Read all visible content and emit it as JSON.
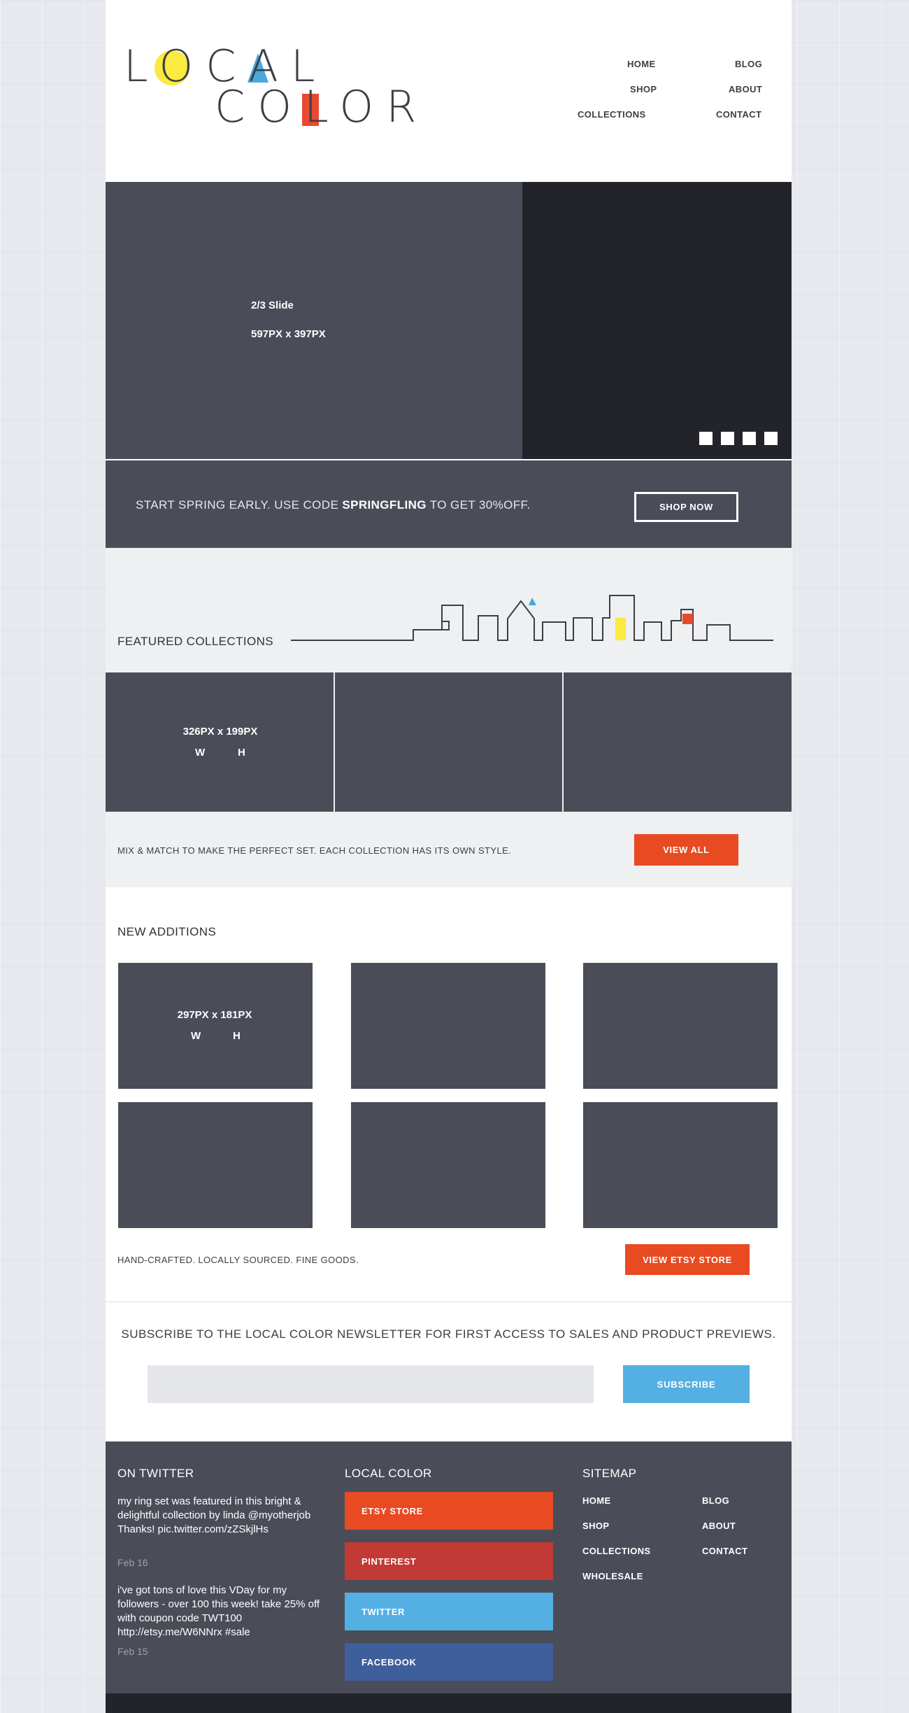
{
  "logo": {
    "line1": "LOCAL",
    "line2": "COLOR"
  },
  "nav": {
    "items": [
      "HOME",
      "BLOG",
      "SHOP",
      "ABOUT",
      "COLLECTIONS",
      "CONTACT"
    ]
  },
  "slider": {
    "title": "2/3 Slide",
    "dims": "597PX x 397PX",
    "dot_count": 4
  },
  "promo": {
    "text_before": "START SPRING EARLY. USE CODE ",
    "code": "SPRINGFLING",
    "text_after": " TO GET 30%OFF.",
    "button": "SHOP NOW"
  },
  "featured": {
    "title": "FEATURED COLLECTIONS",
    "dims": "326PX x 199PX",
    "w": "W",
    "h": "H"
  },
  "mix": {
    "text": "MIX & MATCH TO MAKE THE PERFECT SET. EACH COLLECTION HAS ITS OWN STYLE.",
    "button": "VIEW ALL"
  },
  "new_additions": {
    "title": "NEW ADDITIONS",
    "dims": "297PX x 181PX",
    "w": "W",
    "h": "H",
    "tagline": "HAND-CRAFTED. LOCALLY SOURCED. FINE GOODS.",
    "button": "VIEW ETSY STORE"
  },
  "newsletter": {
    "text": "SUBSCRIBE TO THE LOCAL COLOR NEWSLETTER FOR FIRST ACCESS TO SALES AND PRODUCT PREVIEWS.",
    "placeholder": "",
    "button": "SUBSCRIBE"
  },
  "footer": {
    "twitter_title": "ON TWITTER",
    "tweets": [
      {
        "text": "my ring set was featured in this bright & delightful collection by linda @myotherjob Thanks! pic.twitter.com/zZSkjlHs",
        "date": "Feb 16"
      },
      {
        "text": "i've got tons of love this VDay for my followers - over 100 this week! take 25% off with coupon code TWT100 http://etsy.me/W6NNrx  #sale",
        "date": "Feb 15"
      }
    ],
    "local_title": "LOCAL COLOR",
    "social": [
      {
        "label": "ETSY STORE",
        "color": "#e84a22"
      },
      {
        "label": "PINTEREST",
        "color": "#c23a35"
      },
      {
        "label": "TWITTER",
        "color": "#54b0e2"
      },
      {
        "label": "FACEBOOK",
        "color": "#3f5e9c"
      }
    ],
    "sitemap_title": "SITEMAP",
    "sitemap": [
      "HOME",
      "BLOG",
      "SHOP",
      "ABOUT",
      "COLLECTIONS",
      "CONTACT",
      "WHOLESALE"
    ]
  },
  "colors": {
    "accent_orange": "#e84a22",
    "accent_blue": "#54b0e2",
    "accent_yellow": "#fbea3f",
    "dark_slate": "#4a4d57"
  }
}
